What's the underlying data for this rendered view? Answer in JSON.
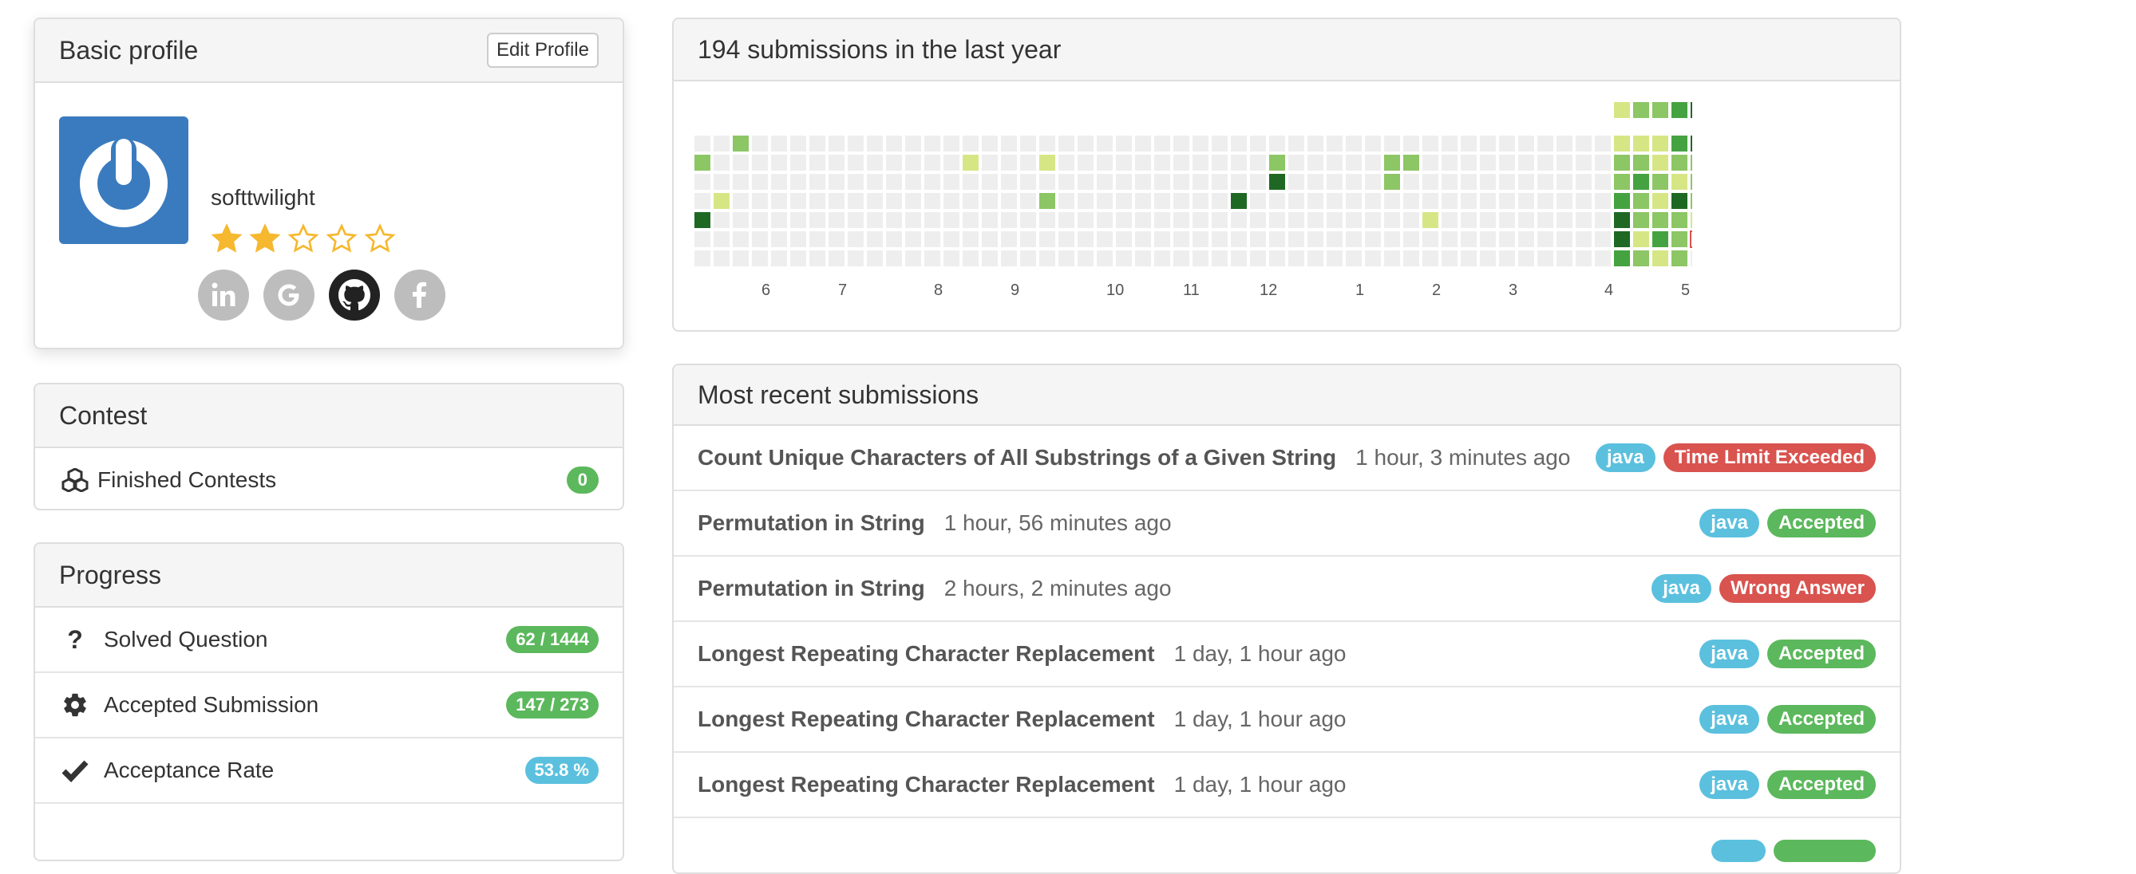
{
  "profile": {
    "title": "Basic profile",
    "edit_label": "Edit Profile",
    "username": "softtwilight",
    "rating": 2,
    "rating_max": 5,
    "socials": [
      "linkedin-icon",
      "google-icon",
      "github-icon",
      "facebook-icon"
    ]
  },
  "contest": {
    "title": "Contest",
    "rows": [
      {
        "label": "Finished Contests",
        "value": "0",
        "icon": "cubes-icon"
      }
    ]
  },
  "progress": {
    "title": "Progress",
    "rows": [
      {
        "label": "Solved Question",
        "value": "62 / 1444",
        "icon": "question-icon"
      },
      {
        "label": "Accepted Submission",
        "value": "147 / 273",
        "icon": "gear-icon"
      },
      {
        "label": "Acceptance Rate",
        "value": "53.8 %",
        "icon": "check-icon"
      }
    ]
  },
  "calendar": {
    "title": "194 submissions in the last year",
    "months": [
      "6",
      "7",
      "8",
      "9",
      "10",
      "11",
      "12",
      "1",
      "2",
      "3",
      "4",
      "5"
    ],
    "colors": {
      "empty": "#eeeeee",
      "l1": "#d6e685",
      "l2": "#8cc665",
      "l3": "#44a340",
      "l4": "#1e6823",
      "today_border": "#d9534f"
    }
  },
  "recent": {
    "title": "Most recent submissions",
    "items": [
      {
        "title": "Count Unique Characters of All Substrings of a Given String",
        "time": "1 hour, 3 minutes ago",
        "lang": "java",
        "status": "Time Limit Exceeded",
        "kind": "bad"
      },
      {
        "title": "Permutation in String",
        "time": "1 hour, 56 minutes ago",
        "lang": "java",
        "status": "Accepted",
        "kind": "ok"
      },
      {
        "title": "Permutation in String",
        "time": "2 hours, 2 minutes ago",
        "lang": "java",
        "status": "Wrong Answer",
        "kind": "bad"
      },
      {
        "title": "Longest Repeating Character Replacement",
        "time": "1 day, 1 hour ago",
        "lang": "java",
        "status": "Accepted",
        "kind": "ok"
      },
      {
        "title": "Longest Repeating Character Replacement",
        "time": "1 day, 1 hour ago",
        "lang": "java",
        "status": "Accepted",
        "kind": "ok"
      },
      {
        "title": "Longest Repeating Character Replacement",
        "time": "1 day, 1 hour ago",
        "lang": "java",
        "status": "Accepted",
        "kind": "ok"
      }
    ]
  }
}
